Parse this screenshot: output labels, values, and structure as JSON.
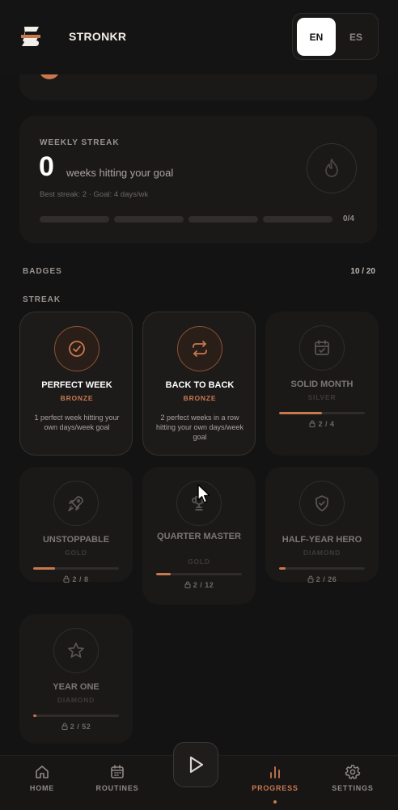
{
  "app": {
    "brand": "STRONKR"
  },
  "language": {
    "options": [
      "EN",
      "ES"
    ],
    "selected": "EN"
  },
  "streak": {
    "label": "WEEKLY STREAK",
    "value": "0",
    "unit_text": "weeks hitting your goal",
    "meta": "Best streak: 2 · Goal: 4 days/wk",
    "progress_text": "0/4",
    "weeks_filled": 0,
    "weeks_total": 4,
    "icon": "flame-icon"
  },
  "badges": {
    "title": "BADGES",
    "count": "10 / 20",
    "group_title": "STREAK",
    "items": [
      {
        "name": "PERFECT WEEK",
        "tier": "BRONZE",
        "earned": true,
        "icon": "check-circle-icon",
        "description": "1 perfect week hitting your own days/week goal"
      },
      {
        "name": "BACK TO BACK",
        "tier": "BRONZE",
        "earned": true,
        "icon": "repeat-icon",
        "description": "2 perfect weeks in a row hitting your own days/week goal"
      },
      {
        "name": "SOLID MONTH",
        "tier": "SILVER",
        "earned": false,
        "icon": "calendar-check-icon",
        "progress": "2 / 4",
        "fraction": 0.5
      },
      {
        "name": "UNSTOPPABLE",
        "tier": "GOLD",
        "earned": false,
        "icon": "rocket-icon",
        "progress": "2 / 8",
        "fraction": 0.25
      },
      {
        "name": "QUARTER MASTER",
        "tier": "GOLD",
        "earned": false,
        "icon": "trophy-icon",
        "progress": "2 / 12",
        "fraction": 0.167
      },
      {
        "name": "HALF-YEAR HERO",
        "tier": "DIAMOND",
        "earned": false,
        "icon": "shield-check-icon",
        "progress": "2 / 26",
        "fraction": 0.077
      },
      {
        "name": "YEAR ONE",
        "tier": "DIAMOND",
        "earned": false,
        "icon": "star-icon",
        "progress": "2 / 52",
        "fraction": 0.038
      }
    ]
  },
  "nav": {
    "items": [
      {
        "label": "HOME",
        "icon": "home-icon"
      },
      {
        "label": "ROUTINES",
        "icon": "calendar-icon"
      },
      {
        "label": "PROGRESS",
        "icon": "bar-chart-icon",
        "active": true
      },
      {
        "label": "SETTINGS",
        "icon": "gear-icon"
      }
    ],
    "center_action_icon": "play-icon"
  },
  "colors": {
    "accent": "#c8784e",
    "background": "#141313",
    "card": "#1a1918"
  }
}
